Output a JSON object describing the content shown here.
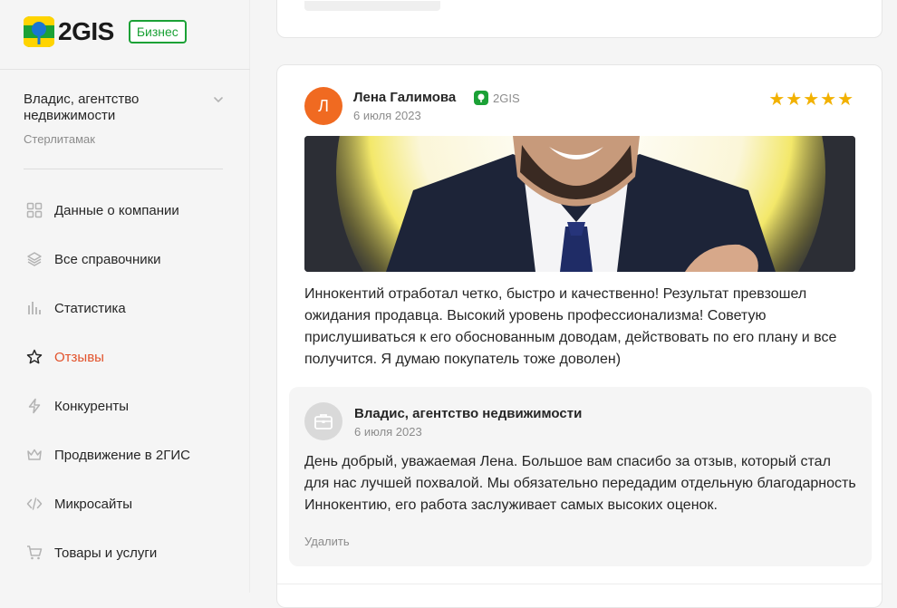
{
  "brand": {
    "logo_text": "2GIS",
    "badge": "Бизнес",
    "accent": "#1ba136"
  },
  "company": {
    "name": "Владис, агентство недвижимости",
    "city": "Стерлитамак"
  },
  "nav": [
    {
      "label": "Данные о компании",
      "icon": "grid-icon",
      "active": false
    },
    {
      "label": "Все справочники",
      "icon": "layers-icon",
      "active": false
    },
    {
      "label": "Статистика",
      "icon": "bar-chart-icon",
      "active": false
    },
    {
      "label": "Отзывы",
      "icon": "star-icon",
      "active": true
    },
    {
      "label": "Конкуренты",
      "icon": "lightning-icon",
      "active": false
    },
    {
      "label": "Продвижение в 2ГИС",
      "icon": "crown-icon",
      "active": false
    },
    {
      "label": "Микросайты",
      "icon": "code-icon",
      "active": false
    },
    {
      "label": "Товары и услуги",
      "icon": "cart-icon",
      "active": false
    }
  ],
  "active_color": "#e2522b",
  "review": {
    "avatar_letter": "Л",
    "author": "Лена Галимова",
    "source": "2GIS",
    "date": "6 июля 2023",
    "rating": 5,
    "stars": "★★★★★",
    "text": "Иннокентий отработал четко, быстро и качественно! Результат превзошел ожидания продавца. Высокий уровень профессионализма! Советую прислушиваться к его обоснованным доводам, действовать по его плану и все получится. Я думаю покупатель тоже доволен)"
  },
  "reply": {
    "author": "Владис, агентство недвижимости",
    "date": "6 июля 2023",
    "text": "День добрый, уважаемая Лена. Большое вам спасибо за отзыв, который стал для нас лучшей похвалой. Мы обязательно передадим отдельную благодарность Иннокентию, его работа заслуживает самых высоких оценок.",
    "delete_label": "Удалить"
  }
}
